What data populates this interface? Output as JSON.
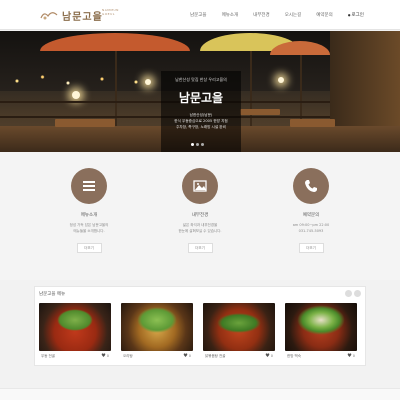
{
  "header": {
    "logo_text": "남문고을",
    "logo_sub": "NAMMUN GOEUL",
    "nav": [
      "남문고을",
      "메뉴소개",
      "내부전경",
      "오시는길",
      "예약문의"
    ],
    "login": "로그인"
  },
  "hero": {
    "top": "남한산성 맛집 한상 우리고을의",
    "title": "남문고을",
    "lines": [
      "남한산성(남문)",
      "한식 우동중심으로 2005 한방 지점",
      "주차장, 족구장, 노래방 시설 완비"
    ],
    "dots": 3,
    "active_dot": 0
  },
  "features": [
    {
      "icon": "menu-list-icon",
      "title": "메뉴소개",
      "desc": [
        "정성 가득 담은 남문고을의",
        "메뉴들을 소개합니다."
      ],
      "button": "더보기"
    },
    {
      "icon": "image-gallery-icon",
      "title": "내부전경",
      "desc": [
        "넓은 좌석과 내부전경을",
        "한눈에 살펴보실 수 있습니다."
      ],
      "button": "더보기"
    },
    {
      "icon": "phone-icon",
      "title": "예약문의",
      "desc": [
        "am 09:00~pm 22:00",
        "031-745-5093"
      ],
      "button": "더보기"
    }
  ],
  "gallery": {
    "title": "남문고을 메뉴",
    "items": [
      {
        "name": "우동 전골",
        "likes": "0"
      },
      {
        "name": "오리탕",
        "likes": "0"
      },
      {
        "name": "닭볶음탕 전골",
        "likes": "0"
      },
      {
        "name": "한방 백숙",
        "likes": "0"
      }
    ]
  },
  "colors": {
    "accent": "#8a6f5c",
    "brand_text": "#8a6d4b"
  }
}
